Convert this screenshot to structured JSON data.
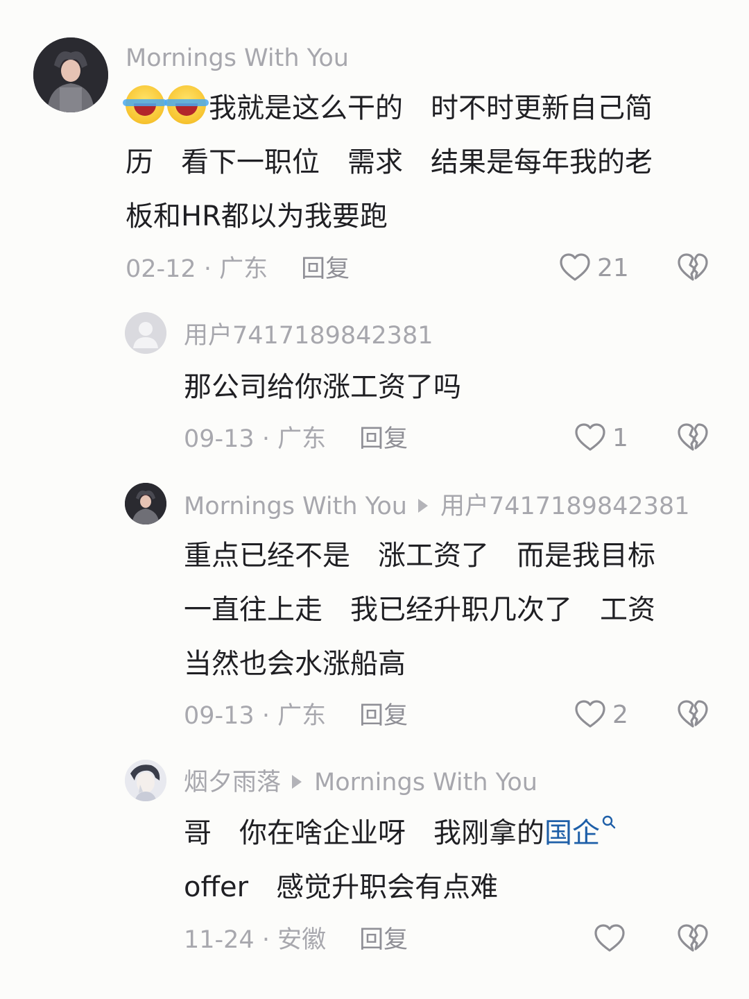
{
  "comments": [
    {
      "username": "Mornings With You",
      "emoji": [
        "tears-of-joy-icon",
        "tears-of-joy-icon"
      ],
      "lines": [
        "我就是这么干的　时不时更新自己简",
        "历　看下一职位　需求　结果是每年我的老",
        "板和HR都以为我要跑"
      ],
      "date": "02-12",
      "location": "广东",
      "reply_label": "回复",
      "likes": "21"
    },
    {
      "username": "用户7417189842381",
      "lines": [
        "那公司给你涨工资了吗"
      ],
      "date": "09-13",
      "location": "广东",
      "reply_label": "回复",
      "likes": "1"
    },
    {
      "username": "Mornings With You",
      "reply_to": "用户7417189842381",
      "lines": [
        "重点已经不是　涨工资了　而是我目标",
        "一直往上走　我已经升职几次了　工资",
        "当然也会水涨船高"
      ],
      "date": "09-13",
      "location": "广东",
      "reply_label": "回复",
      "likes": "2"
    },
    {
      "username": "烟夕雨落",
      "reply_to": "Mornings With You",
      "line1_text": "哥　你在啥企业呀　我刚拿的",
      "line1_link": "国企",
      "line2": "offer　感觉升职会有点难",
      "date": "11-24",
      "location": "安徽",
      "reply_label": "回复",
      "likes": ""
    }
  ],
  "separator": " · ",
  "colors": {
    "background": "#fcfcfa",
    "text": "#1f1f23",
    "muted": "#a8a8ae",
    "link": "#1e5fa8"
  }
}
